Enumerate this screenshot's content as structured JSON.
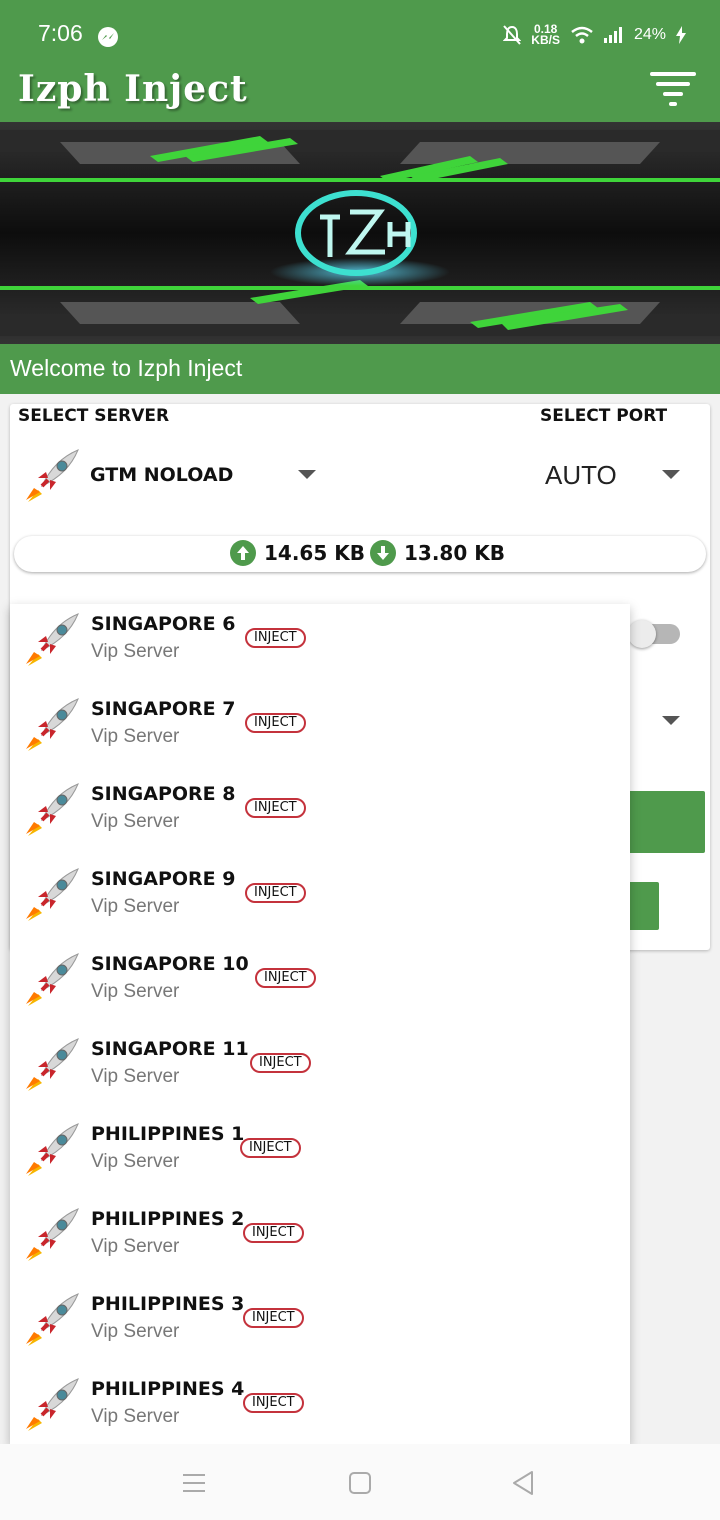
{
  "status_bar": {
    "time": "7:06",
    "speed_value": "0.18",
    "speed_unit": "KB/S",
    "battery": "24%"
  },
  "app": {
    "title": "Izph Inject",
    "welcome": "Welcome to Izph Inject"
  },
  "selectors": {
    "server_label": "SELECT SERVER",
    "port_label": "SELECT PORT",
    "selected_server": "GTM NOLOAD",
    "selected_port": "AUTO"
  },
  "traffic": {
    "upload": "14.65 KB",
    "download": "13.80 KB"
  },
  "server_list": [
    {
      "name": "SINGAPORE 6",
      "subtitle": "Vip Server",
      "badge": "INJECT"
    },
    {
      "name": "SINGAPORE 7",
      "subtitle": "Vip Server",
      "badge": "INJECT"
    },
    {
      "name": "SINGAPORE 8",
      "subtitle": "Vip Server",
      "badge": "INJECT"
    },
    {
      "name": "SINGAPORE 9",
      "subtitle": "Vip Server",
      "badge": "INJECT"
    },
    {
      "name": "SINGAPORE 10",
      "subtitle": "Vip Server",
      "badge": "INJECT"
    },
    {
      "name": "SINGAPORE 11",
      "subtitle": "Vip Server",
      "badge": "INJECT"
    },
    {
      "name": "PHILIPPINES 1",
      "subtitle": "Vip Server",
      "badge": "INJECT"
    },
    {
      "name": "PHILIPPINES 2",
      "subtitle": "Vip Server",
      "badge": "INJECT"
    },
    {
      "name": "PHILIPPINES 3",
      "subtitle": "Vip Server",
      "badge": "INJECT"
    },
    {
      "name": "PHILIPPINES 4",
      "subtitle": "Vip Server",
      "badge": "INJECT"
    }
  ],
  "colors": {
    "primary_green": "#4f9a4c",
    "badge_border": "#c4323c"
  },
  "icons": [
    "messenger-icon",
    "bell-off-icon",
    "wifi-icon",
    "signal-icon",
    "charging-icon",
    "filter-menu-icon",
    "rocket-icon",
    "upload-arrow-icon",
    "download-arrow-icon",
    "nav-menu-icon",
    "nav-home-icon",
    "nav-back-icon"
  ]
}
